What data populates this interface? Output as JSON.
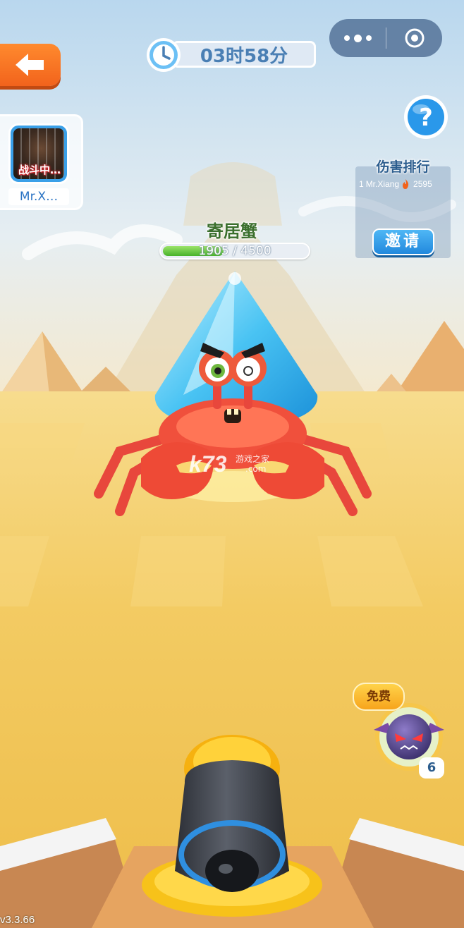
{
  "timer": {
    "text": "03时58分"
  },
  "capsule": {
    "more_icon": "more-dots-icon",
    "close_icon": "target-close-icon"
  },
  "player": {
    "status": "战斗中…",
    "name": "Mr.X…"
  },
  "ranking": {
    "title": "伤害排行",
    "entries": [
      {
        "rank": "1",
        "name": "Mr.Xiang",
        "score": "2595"
      }
    ],
    "invite_label": "邀请"
  },
  "boss": {
    "name": "寄居蟹",
    "hp_current": 1905,
    "hp_max": 4500,
    "hp_text": "1905 / 4500",
    "hp_fraction": 0.423
  },
  "skill": {
    "free_label": "免费",
    "count": "6"
  },
  "watermark": {
    "main": "k73",
    "sub1": "游戏之家",
    "sub2": ".com"
  },
  "version": "v3.3.66",
  "colors": {
    "accent_orange": "#f2631c",
    "accent_blue": "#2289dd",
    "hp_green": "#48b22a",
    "sand": "#f2c85a",
    "sky": "#cfe4f3"
  }
}
